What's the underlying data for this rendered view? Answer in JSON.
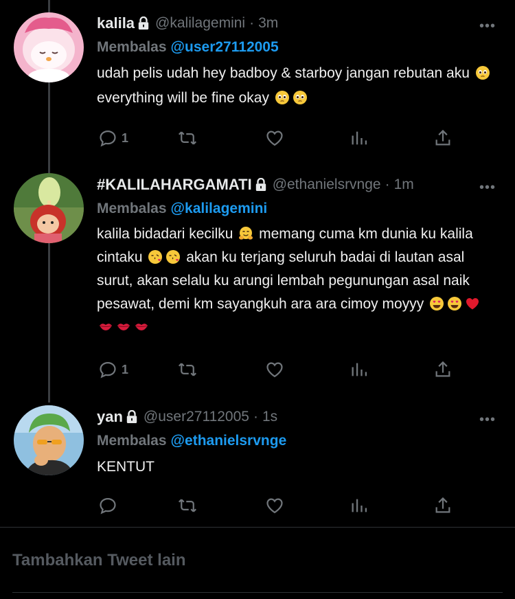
{
  "tweets": [
    {
      "name": "kalila",
      "handle": "@kalilagemini",
      "time": "3m",
      "replying_label": "Membalas",
      "replying_to": "@user27112005",
      "text_parts": [
        "udah pelis udah hey badboy & starboy jangan rebutan aku ",
        " everything will be fine okay "
      ],
      "reply_count": "1"
    },
    {
      "name": "#KALILAHARGAMATI",
      "handle": "@ethanielsrvnge",
      "time": "1m",
      "replying_label": "Membalas",
      "replying_to": "@kalilagemini",
      "text_parts": [
        "kalila bidadari kecilku ",
        " memang cuma km dunia ku kalila cintaku ",
        " akan ku terjang seluruh badai di lautan asal surut, akan selalu ku arungi lembah pegunungan asal naik pesawat, demi km sayangkuh ara ara cimoy moyyy "
      ],
      "reply_count": "1"
    },
    {
      "name": "yan",
      "handle": "@user27112005",
      "time": "1s",
      "replying_label": "Membalas",
      "replying_to": "@ethanielsrvnge",
      "text_parts": [
        "KENTUT"
      ],
      "reply_count": ""
    }
  ],
  "separator": "·",
  "more_label": "•••",
  "compose_placeholder": "Tambahkan Tweet lain",
  "icons": [
    "lock-icon",
    "more-icon",
    "reply-icon",
    "retweet-icon",
    "like-icon",
    "analytics-icon",
    "share-icon",
    "pleading-face-emoji",
    "hugging-face-emoji",
    "kissing-face-emoji",
    "heart-eyes-emoji",
    "red-heart-emoji",
    "kiss-mark-emoji"
  ],
  "colors": {
    "background": "#000000",
    "mention": "#1d9bf0",
    "muted": "#71767b",
    "text": "#e7e9ea"
  }
}
